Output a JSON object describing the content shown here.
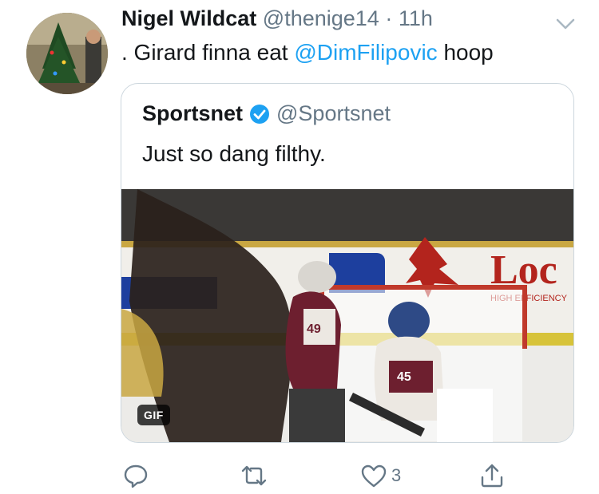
{
  "tweet": {
    "author_name": "Nigel Wildcat",
    "author_handle": "@thenige14",
    "separator": "·",
    "time": "11h",
    "text_before": ". Girard finna eat ",
    "mention": "@DimFilipovic",
    "text_after": " hoop"
  },
  "quoted_tweet": {
    "author_name": "Sportsnet",
    "author_handle": "@Sportsnet",
    "text": "Just so dang filthy.",
    "media": {
      "badge": "GIF",
      "rink_text": "Loc",
      "rink_subtext": "HIGH EFFICIENCY",
      "jersey_numbers": [
        "49",
        "45"
      ]
    }
  },
  "actions": {
    "reply_count": "",
    "retweet_count": "",
    "like_count": "3"
  },
  "colors": {
    "accent": "#1da1f2",
    "muted": "#657786",
    "text": "#14171a",
    "border": "#ccd6dd"
  }
}
